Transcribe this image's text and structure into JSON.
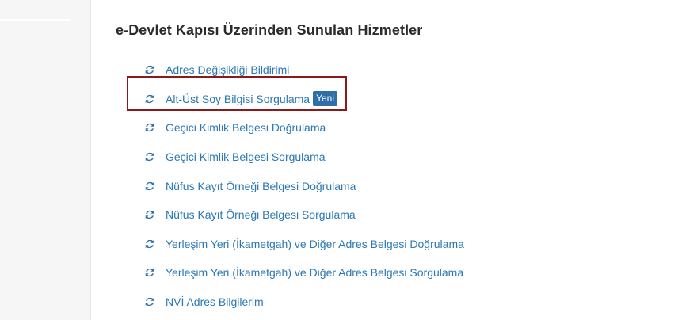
{
  "section": {
    "title": "e-Devlet Kapısı Üzerinden Sunulan Hizmetler"
  },
  "services": [
    {
      "label": "Adres Değişikliği Bildirimi"
    },
    {
      "label": "Alt-Üst Soy Bilgisi Sorgulama",
      "badge": "Yeni"
    },
    {
      "label": "Geçici Kimlik Belgesi Doğrulama"
    },
    {
      "label": "Geçici Kimlik Belgesi Sorgulama"
    },
    {
      "label": "Nüfus Kayıt Örneği Belgesi Doğrulama"
    },
    {
      "label": "Nüfus Kayıt Örneği Belgesi Sorgulama"
    },
    {
      "label": "Yerleşim Yeri (İkametgah) ve Diğer Adres Belgesi Doğrulama"
    },
    {
      "label": "Yerleşim Yeri (İkametgah) ve Diğer Adres Belgesi Sorgulama"
    },
    {
      "label": "NVİ Adres Bilgilerim"
    }
  ],
  "icons": {
    "service": "refresh-icon"
  },
  "colors": {
    "link": "#2a78b4",
    "icon": "#2f6fa8",
    "badge_bg": "#2f6fa8",
    "badge_text": "#ffffff",
    "highlight": "#8b1a1a",
    "title": "#2b2b2b"
  }
}
